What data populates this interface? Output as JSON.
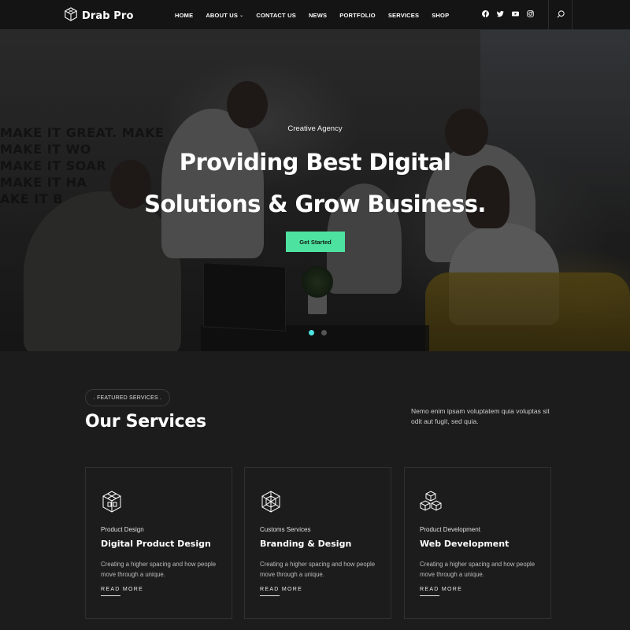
{
  "header": {
    "brand": "Drab Pro",
    "nav": [
      {
        "label": "HOME",
        "has_dropdown": false
      },
      {
        "label": "ABOUT US",
        "has_dropdown": true
      },
      {
        "label": "CONTACT US",
        "has_dropdown": false
      },
      {
        "label": "NEWS",
        "has_dropdown": false
      },
      {
        "label": "PORTFOLIO",
        "has_dropdown": false
      },
      {
        "label": "SERVICES",
        "has_dropdown": false
      },
      {
        "label": "SHOP",
        "has_dropdown": false
      }
    ],
    "socials": [
      "facebook-icon",
      "twitter-icon",
      "youtube-icon",
      "instagram-icon"
    ],
    "search_icon": "search-icon"
  },
  "hero": {
    "subtitle": "Creative Agency",
    "title_line1": "Providing Best Digital",
    "title_line2": "Solutions & Grow Business.",
    "cta": "Get Started",
    "slides_count": 2,
    "active_slide": 1,
    "accent_color": "#4ee2a0"
  },
  "services": {
    "badge": ". FEATURED SERVICES .",
    "title": "Our Services",
    "description": "Nemo enim ipsam voluptatem quia voluptas sit odit aut fugit, sed quia.",
    "cards": [
      {
        "icon": "cube-stack-icon",
        "category": "Product Design",
        "title": "Digital Product Design",
        "text": "Creating a higher spacing and how people move through a unique.",
        "link": "READ MORE"
      },
      {
        "icon": "cube-cross-icon",
        "category": "Customs Services",
        "title": "Branding & Design",
        "text": "Creating a higher spacing and how people move through a unique.",
        "link": "READ MORE"
      },
      {
        "icon": "cubes-icon",
        "category": "Product Development",
        "title": "Web Development",
        "text": "Creating a higher spacing and how people move through a unique.",
        "link": "READ MORE"
      }
    ]
  }
}
